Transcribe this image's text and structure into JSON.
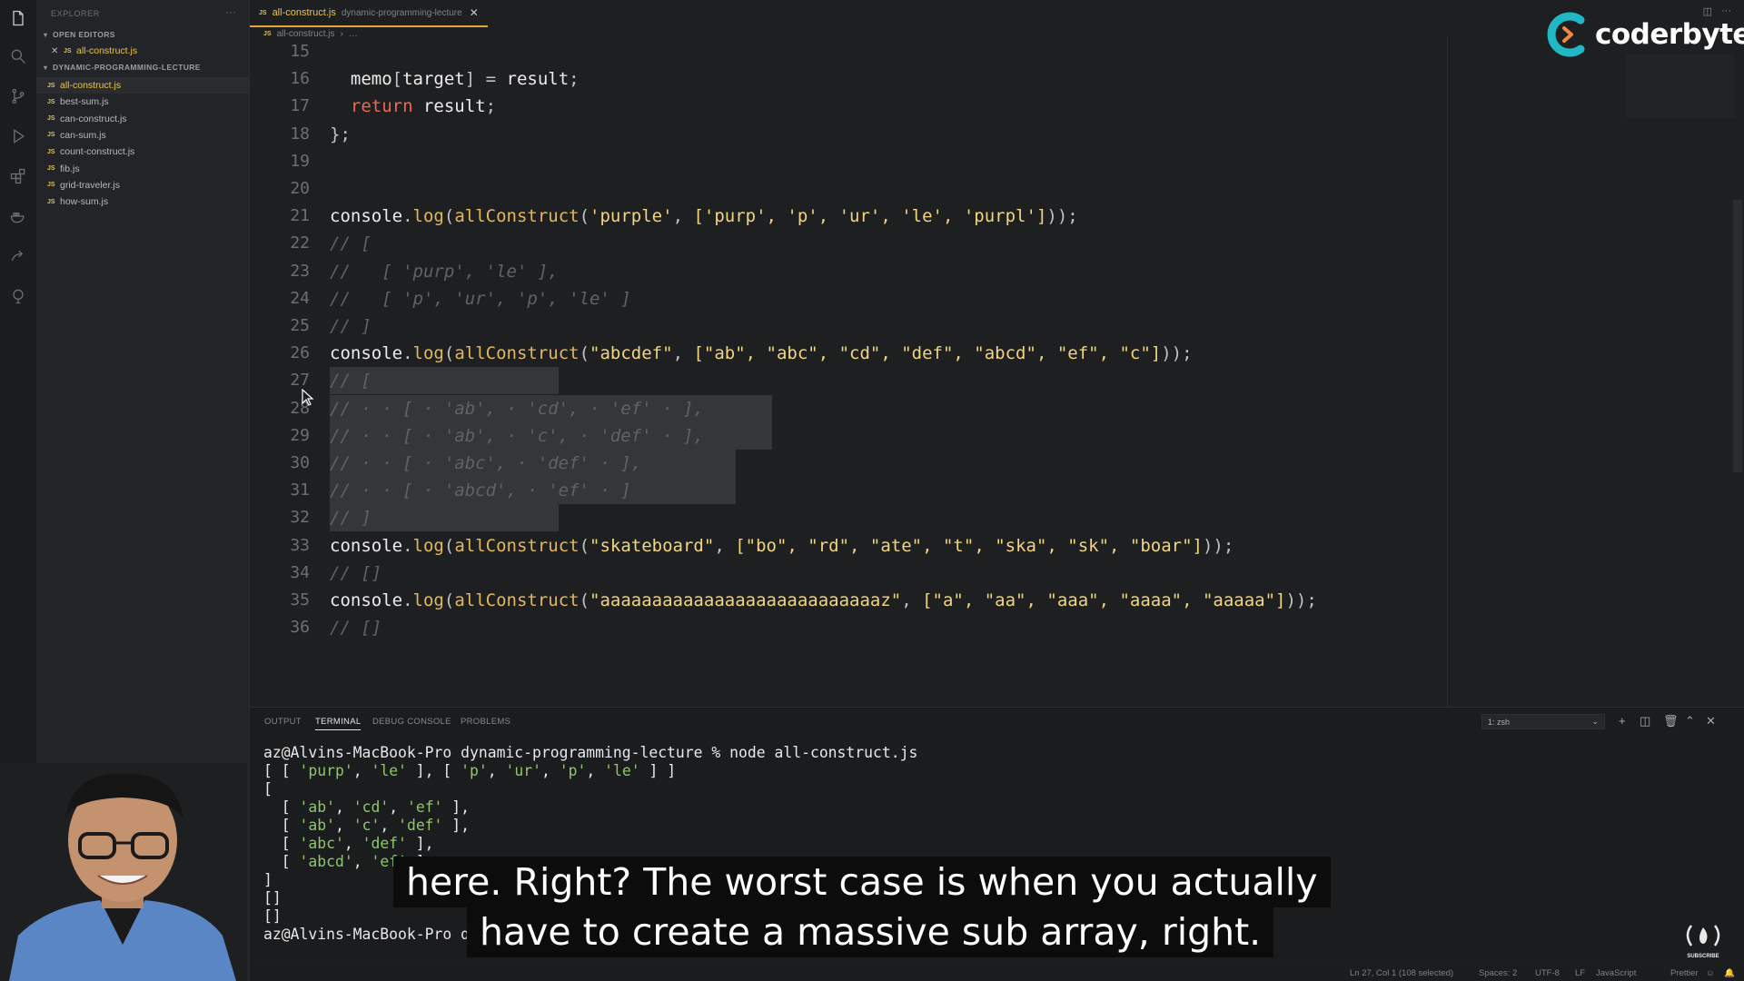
{
  "sidebar": {
    "title": "EXPLORER",
    "more": "···",
    "open_editors_label": "OPEN EDITORS",
    "open_editor": {
      "close": "✕",
      "name": "all-construct.js"
    },
    "folder_label": "DYNAMIC-PROGRAMMING-LECTURE",
    "js_badge": "JS",
    "files": [
      {
        "name": "all-construct.js"
      },
      {
        "name": "best-sum.js"
      },
      {
        "name": "can-construct.js"
      },
      {
        "name": "can-sum.js"
      },
      {
        "name": "count-construct.js"
      },
      {
        "name": "fib.js"
      },
      {
        "name": "grid-traveler.js"
      },
      {
        "name": "how-sum.js"
      }
    ]
  },
  "tab": {
    "badge": "JS",
    "name": "all-construct.js",
    "dir": "dynamic-programming-lecture",
    "close": "✕"
  },
  "breadcrumb": {
    "badge": "JS",
    "file": "all-construct.js",
    "sep": "›",
    "more": "…"
  },
  "logo": {
    "word": "coderbyte"
  },
  "code": {
    "lines": [
      {
        "n": "15",
        "t": ""
      },
      {
        "n": "16",
        "t": ""
      },
      {
        "n": "17",
        "t": ""
      },
      {
        "n": "18",
        "t": "};"
      },
      {
        "n": "19",
        "t": ""
      },
      {
        "n": "20",
        "t": ""
      },
      {
        "n": "21",
        "t": ""
      },
      {
        "n": "22",
        "t": "// ["
      },
      {
        "n": "23",
        "t": "//   [ 'purp', 'le' ],"
      },
      {
        "n": "24",
        "t": "//   [ 'p', 'ur', 'p', 'le' ]"
      },
      {
        "n": "25",
        "t": "// ]"
      },
      {
        "n": "26",
        "t": ""
      },
      {
        "n": "27",
        "t": "// ["
      },
      {
        "n": "28",
        "t": "// · · [ · 'ab', · 'cd', · 'ef' · ],"
      },
      {
        "n": "29",
        "t": "// · · [ · 'ab', · 'c', · 'def' · ],"
      },
      {
        "n": "30",
        "t": "// · · [ · 'abc', · 'def' · ],"
      },
      {
        "n": "31",
        "t": "// · · [ · 'abcd', · 'ef' · ]"
      },
      {
        "n": "32",
        "t": "// ]"
      },
      {
        "n": "33",
        "t": ""
      },
      {
        "n": "34",
        "t": "// []"
      },
      {
        "n": "35",
        "t": ""
      },
      {
        "n": "36",
        "t": "// []"
      }
    ],
    "line16": {
      "a": "  memo",
      "b": "[",
      "c": "target",
      "d": "] = ",
      "e": "result",
      "f": ";"
    },
    "line17": {
      "kw": "  return ",
      "v": "result",
      "p": ";"
    },
    "calls": {
      "obj": "console",
      "dot": ".",
      "log": "log",
      "fn": "allConstruct",
      "l21": {
        "target": "'purple'",
        "words": "['purp', 'p', 'ur', 'le', 'purpl']"
      },
      "l26": {
        "target": "\"abcdef\"",
        "words": "[\"ab\", \"abc\", \"cd\", \"def\", \"abcd\", \"ef\", \"c\"]"
      },
      "l33": {
        "target": "\"skateboard\"",
        "words": "[\"bo\", \"rd\", \"ate\", \"t\", \"ska\", \"sk\", \"boar\"]"
      },
      "l35": {
        "target": "\"aaaaaaaaaaaaaaaaaaaaaaaaaaaz\"",
        "words": "[\"a\", \"aa\", \"aaa\", \"aaaa\", \"aaaaa\"]"
      }
    }
  },
  "panel": {
    "tabs": [
      "OUTPUT",
      "TERMINAL",
      "DEBUG CONSOLE",
      "PROBLEMS"
    ],
    "shell": "1: zsh",
    "prompt": "az@Alvins-MacBook-Pro dynamic-programming-lecture % node all-construct.js",
    "out1": "[ [ 'purp', 'le' ], [ 'p', 'ur', 'p', 'le' ] ]",
    "out2": "[",
    "out3": "  [ 'ab', 'cd', 'ef' ],",
    "out4": "  [ 'ab', 'c', 'def' ],",
    "out5": "  [ 'abc', 'def' ],",
    "out6": "  [ 'abcd', 'ef' ]",
    "out7": "]",
    "out8": "[]",
    "out9": "[]",
    "prompt2": "az@Alvins-MacBook-Pro dynamic-programming-lecture %"
  },
  "subtitles": {
    "line1": "here. Right? The worst case is when you actually",
    "line2": "have to create a massive sub array, right."
  },
  "status": {
    "position": "Ln 27, Col 1 (108 selected)",
    "spaces": "Spaces: 2",
    "encoding": "UTF-8",
    "eol": "LF",
    "language": "JavaScript",
    "formatter": "Prettier"
  },
  "fcc_label": "SUBSCRIBE",
  "colors": {
    "accent_tab": "#e5a43b",
    "string": "#f2d57e",
    "keyword": "#f0674f",
    "function": "#e2b85a",
    "terminal_green": "#8fc765",
    "logo_teal": "#1fb8c4"
  }
}
